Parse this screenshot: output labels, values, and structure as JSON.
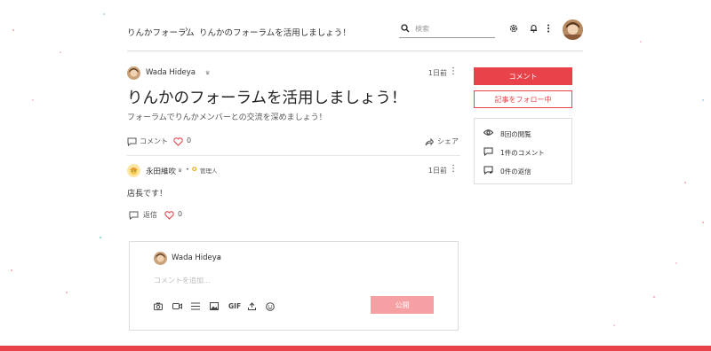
{
  "colors": {
    "accent": "#e8434a",
    "publish_disabled": "#f5a0a3",
    "border": "#dddddd"
  },
  "header": {
    "breadcrumb_root": "りんかフォーラム",
    "breadcrumb_sep": "›",
    "breadcrumb_current": "りんかのフォーラムを活用しましょう！",
    "search_placeholder": "検索",
    "icons": [
      "search-icon",
      "gear-icon",
      "bell-icon",
      "more-vertical-icon",
      "avatar"
    ]
  },
  "post": {
    "author": "Wada Hideya",
    "time": "1日前",
    "title": "りんかのフォーラムを活用しましょう！",
    "subtitle": "フォーラムでりんかメンバーとの交流を深めましょう！",
    "comment_label": "コメント",
    "like_count": "0",
    "share_label": "シェア"
  },
  "comment": {
    "author": "永田維吹",
    "role": "管理人",
    "time": "1日前",
    "text": "店長です！",
    "reply_label": "返信",
    "like_count": "0"
  },
  "composer": {
    "author": "Wada Hideya",
    "placeholder": "コメントを追加...",
    "gif_label": "GIF",
    "publish_label": "公開",
    "tools": [
      "camera-icon",
      "video-icon",
      "divider-icon",
      "image-icon",
      "gif-icon",
      "upload-icon",
      "emoji-icon"
    ]
  },
  "sidebar": {
    "comment_button": "コメント",
    "follow_button": "記事をフォロー中",
    "stats": {
      "views": "8回の閲覧",
      "comments": "1件のコメント",
      "replies": "0件の返信"
    }
  }
}
